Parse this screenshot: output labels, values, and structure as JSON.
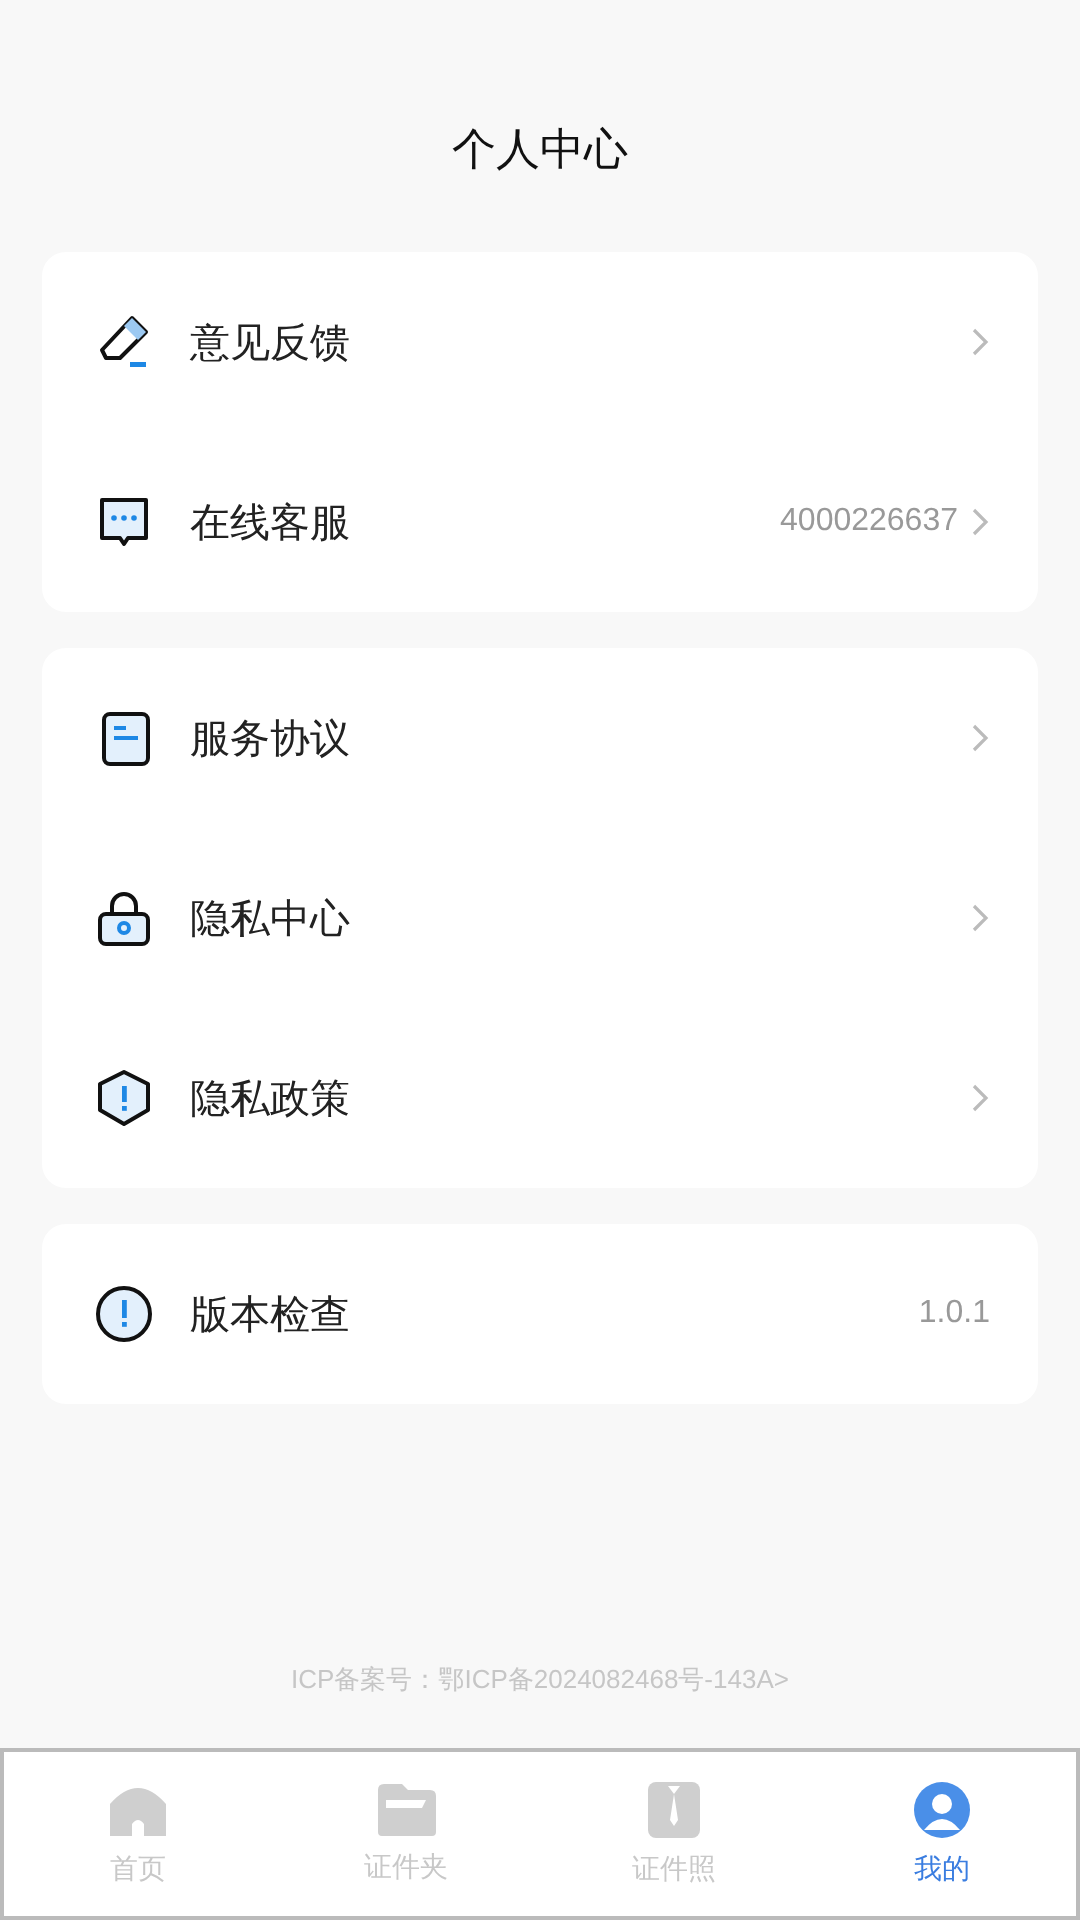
{
  "title": "个人中心",
  "groups": [
    {
      "items": [
        {
          "kind": "pen",
          "label": "意见反馈",
          "chevron": true
        },
        {
          "kind": "chat",
          "label": "在线客服",
          "value": "4000226637",
          "chevron": true
        }
      ]
    },
    {
      "items": [
        {
          "kind": "doc",
          "label": "服务协议",
          "chevron": true
        },
        {
          "kind": "lock",
          "label": "隐私中心",
          "chevron": true
        },
        {
          "kind": "shield",
          "label": "隐私政策",
          "chevron": true
        }
      ]
    },
    {
      "items": [
        {
          "kind": "info",
          "label": "版本检查",
          "value": "1.0.1",
          "chevron": false
        }
      ]
    }
  ],
  "footer": "ICP备案号：鄂ICP备2024082468号-143A>",
  "tabs": [
    {
      "kind": "home",
      "label": "首页",
      "selected": false
    },
    {
      "kind": "folder",
      "label": "证件夹",
      "selected": false
    },
    {
      "kind": "photo",
      "label": "证件照",
      "selected": false
    },
    {
      "kind": "user",
      "label": "我的",
      "selected": true
    }
  ]
}
